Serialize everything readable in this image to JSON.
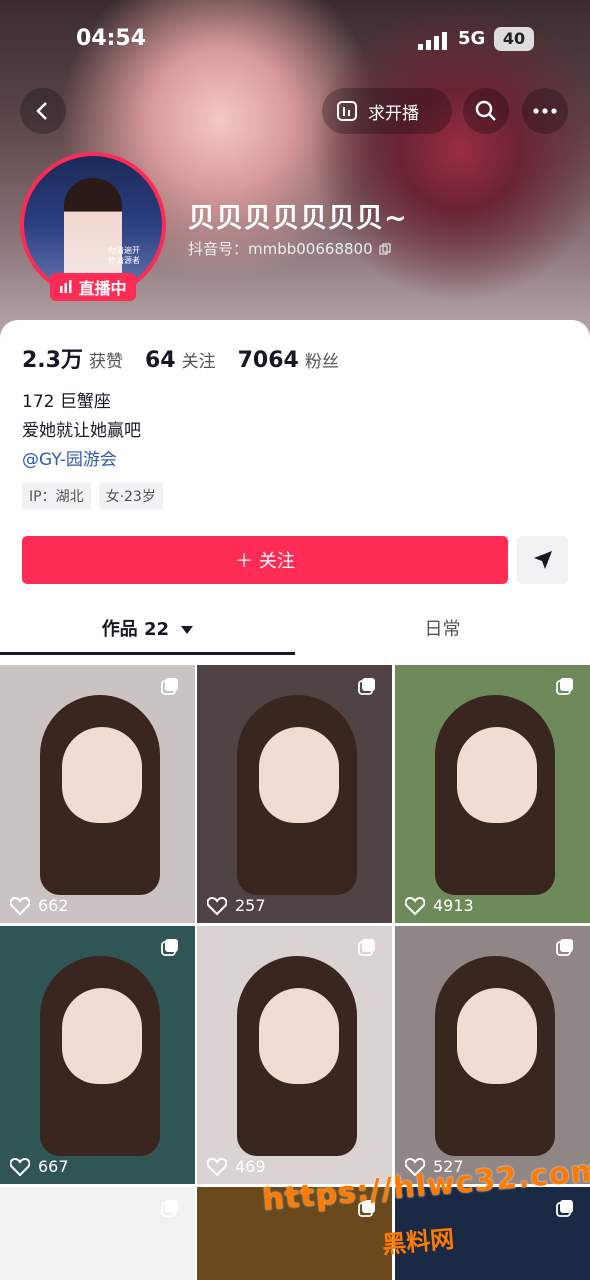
{
  "status_bar": {
    "time": "04:54",
    "network": "5G",
    "battery": "40"
  },
  "header": {
    "start_live_label": "求开播"
  },
  "profile": {
    "name": "贝贝贝贝贝贝贝~",
    "douyin_id": "抖音号：mmbb00668800",
    "live_badge": "直播中",
    "avatar_caption": "你清遍开 修清源者"
  },
  "stats": [
    {
      "value": "2.3万",
      "label": "获赞"
    },
    {
      "value": "64",
      "label": "关注"
    },
    {
      "value": "7064",
      "label": "粉丝"
    }
  ],
  "bio": {
    "line1": "172 巨蟹座",
    "line2": "爱她就让她赢吧",
    "mention": "@GY-园游会"
  },
  "tags": {
    "ip": "IP：湖北",
    "gender_age": "女·23岁"
  },
  "actions": {
    "follow": "＋ 关注"
  },
  "tabs": {
    "works": "作品 22",
    "daily": "日常"
  },
  "posts": [
    {
      "likes": "662",
      "bg": "#c9c3c1"
    },
    {
      "likes": "257",
      "bg": "#4f4443"
    },
    {
      "likes": "4913",
      "bg": "#6f8a5a"
    },
    {
      "likes": "667",
      "bg": "#2f5554"
    },
    {
      "likes": "469",
      "bg": "#d9d4d1"
    },
    {
      "likes": "527",
      "bg": "#8f8685"
    },
    {
      "likes": "",
      "bg": "#f2f2f2"
    },
    {
      "likes": "",
      "bg": "#6a4a1c"
    },
    {
      "likes": "",
      "bg": "#1b2a44"
    }
  ],
  "watermark": {
    "url": "https://hlwc32.com",
    "text": "黑料网"
  },
  "colors": {
    "accent": "#fe2c55",
    "link": "#2b5ab6"
  }
}
